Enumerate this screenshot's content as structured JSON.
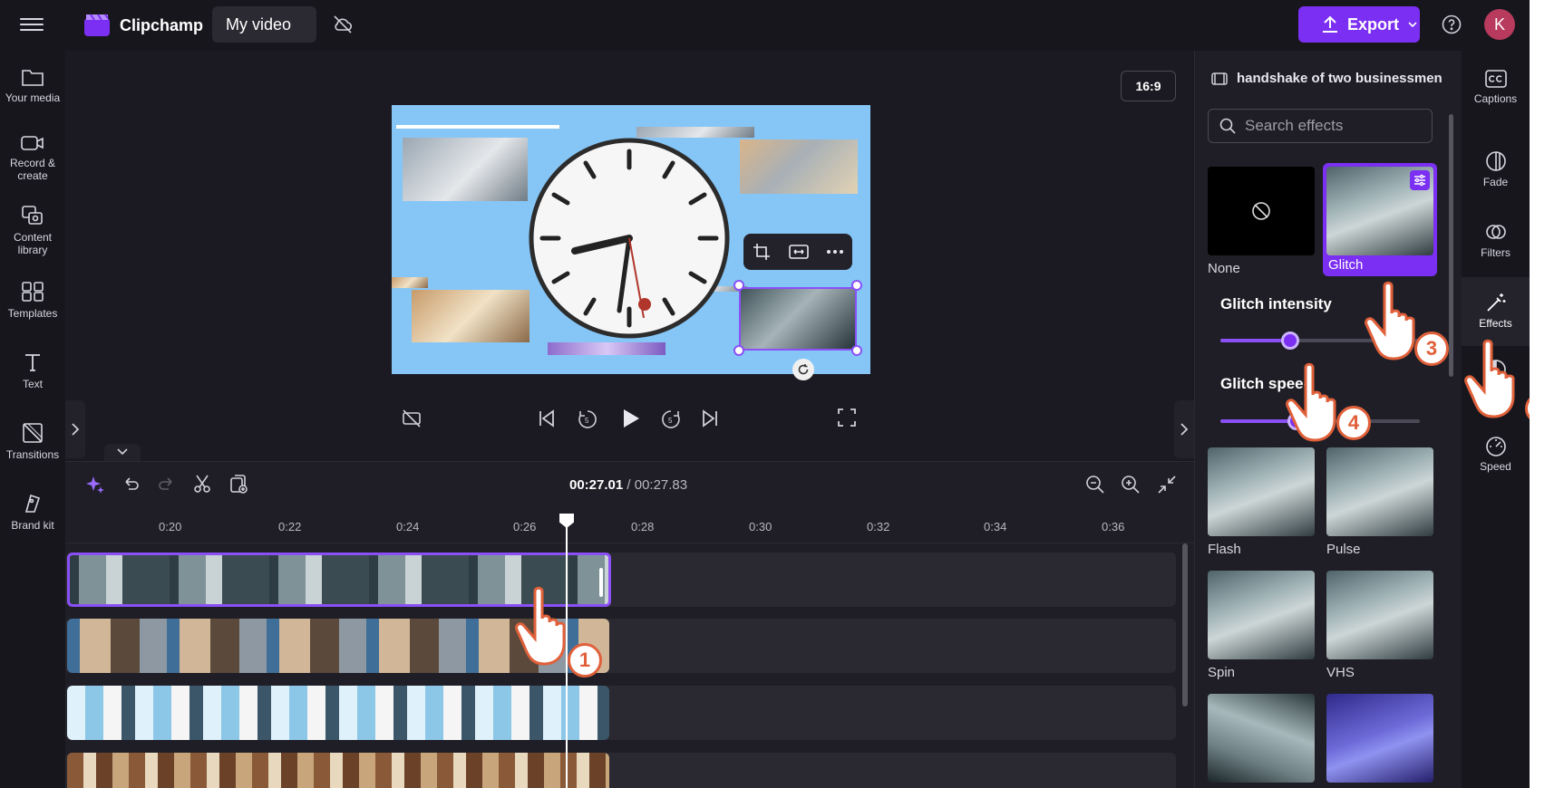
{
  "app": {
    "brand": "Clipchamp",
    "project_title": "My video",
    "export_label": "Export",
    "avatar_initial": "K",
    "accent": "#7b2ff2"
  },
  "left_nav": [
    {
      "label": "Your media"
    },
    {
      "label": "Record & create"
    },
    {
      "label": "Content library"
    },
    {
      "label": "Templates"
    },
    {
      "label": "Text"
    },
    {
      "label": "Transitions"
    },
    {
      "label": "Brand kit"
    }
  ],
  "preview": {
    "aspect_ratio": "16:9"
  },
  "timeline": {
    "current_time": "00:27.01",
    "total_time": "/ 00:27.83",
    "ruler_ticks": [
      "0:20",
      "0:22",
      "0:24",
      "0:26",
      "0:28",
      "0:30",
      "0:32",
      "0:34",
      "0:36"
    ]
  },
  "effects_panel": {
    "asset_name": "handshake of two businessmen",
    "search_placeholder": "Search effects",
    "effects": [
      {
        "label": "None"
      },
      {
        "label": "Glitch"
      },
      {
        "label": "Flash"
      },
      {
        "label": "Pulse"
      },
      {
        "label": "Spin"
      },
      {
        "label": "VHS"
      }
    ],
    "sliders": [
      {
        "label": "Glitch intensity",
        "value": 0.35
      },
      {
        "label": "Glitch speed",
        "value": 0.38
      }
    ]
  },
  "right_rail": [
    {
      "label": "Captions"
    },
    {
      "label": "Fade"
    },
    {
      "label": "Filters"
    },
    {
      "label": "Effects"
    },
    {
      "label": ""
    },
    {
      "label": "Speed"
    }
  ],
  "annotations": {
    "steps": [
      "1",
      "2",
      "3",
      "4"
    ]
  }
}
